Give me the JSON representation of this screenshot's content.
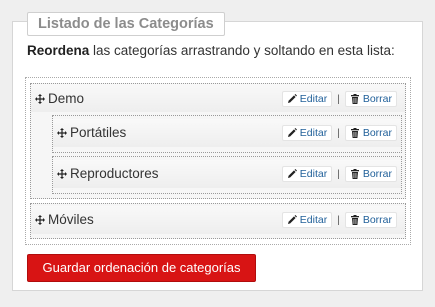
{
  "panel": {
    "title": "Listado de las Categorías",
    "intro_bold": "Reordena",
    "intro_rest": " las categorías arrastrando y soltando en esta lista:"
  },
  "categories": [
    {
      "label": "Demo",
      "edit": "Editar",
      "delete": "Borrar",
      "sep": "|"
    },
    {
      "label": "Portátiles",
      "edit": "Editar",
      "delete": "Borrar",
      "sep": "|"
    },
    {
      "label": "Reproductores",
      "edit": "Editar",
      "delete": "Borrar",
      "sep": "|"
    },
    {
      "label": "Móviles",
      "edit": "Editar",
      "delete": "Borrar",
      "sep": "|"
    }
  ],
  "save_button": "Guardar ordenación de categorías",
  "colors": {
    "save": "#d81414",
    "link": "#1f5f99"
  }
}
